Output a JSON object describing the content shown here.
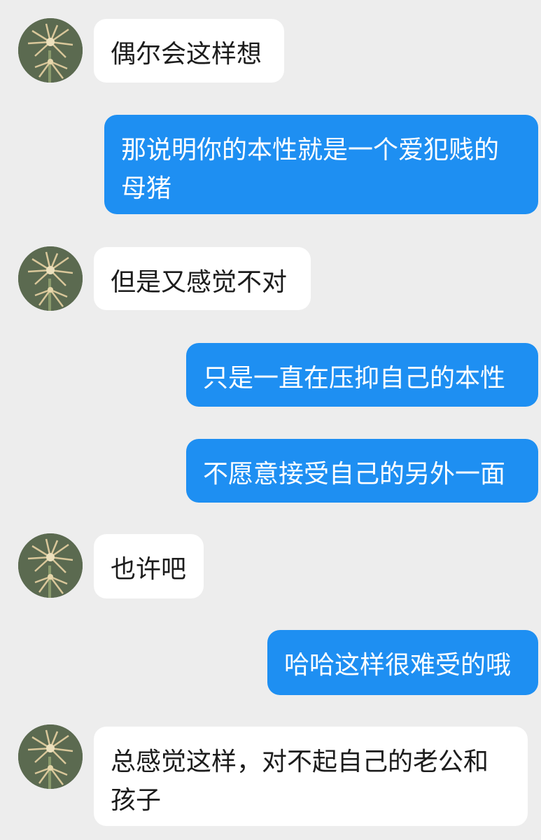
{
  "conversation": {
    "avatar_icon": "flower-avatar-icon",
    "colors": {
      "background": "#ededed",
      "incoming_bubble": "#ffffff",
      "outgoing_bubble": "#1e8ff2",
      "incoming_text": "#1c1c1c",
      "outgoing_text": "#ffffff"
    },
    "messages": [
      {
        "side": "incoming",
        "text": "偶尔会这样想"
      },
      {
        "side": "outgoing",
        "text": "那说明你的本性就是一个爱犯贱的母猪"
      },
      {
        "side": "incoming",
        "text": "但是又感觉不对"
      },
      {
        "side": "outgoing",
        "text": "只是一直在压抑自己的本性"
      },
      {
        "side": "outgoing",
        "text": "不愿意接受自己的另外一面"
      },
      {
        "side": "incoming",
        "text": "也许吧"
      },
      {
        "side": "outgoing",
        "text": "哈哈这样很难受的哦"
      },
      {
        "side": "incoming",
        "text": "总感觉这样，对不起自己的老公和孩子"
      }
    ]
  }
}
